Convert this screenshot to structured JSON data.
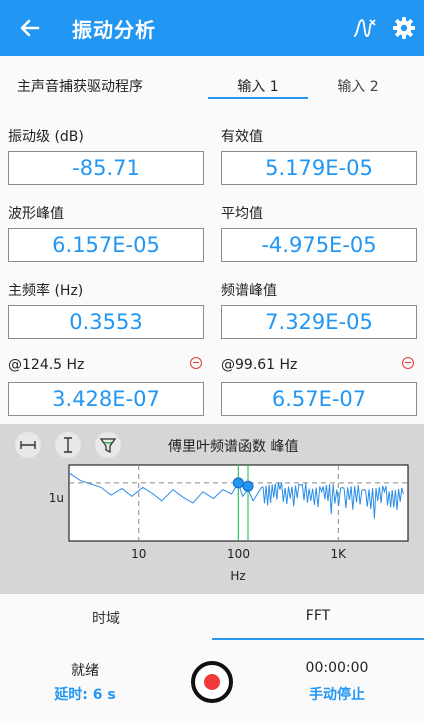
{
  "appbar": {
    "title": "振动分析"
  },
  "subhead": {
    "driver": "主声音捕获驱动程序",
    "tab_input1": "输入 1",
    "tab_input2": "输入 2"
  },
  "fields": [
    {
      "label": "振动级 (dB)",
      "value": "-85.71"
    },
    {
      "label": "有效值",
      "value": "5.179E-05"
    },
    {
      "label": "波形峰值",
      "value": "6.157E-05"
    },
    {
      "label": "平均值",
      "value": "-4.975E-05"
    },
    {
      "label": "主频率 (Hz)",
      "value": "0.3553"
    },
    {
      "label": "频谱峰值",
      "value": "7.329E-05"
    },
    {
      "label": "@124.5 Hz",
      "value": "3.428E-07"
    },
    {
      "label": "@99.61 Hz",
      "value": "6.57E-07"
    }
  ],
  "chart": {
    "title": "傅里叶频谱函数 峰值",
    "xlabel": "Hz",
    "ytick": "1u",
    "xticks": [
      "10",
      "100",
      "1K"
    ]
  },
  "chart_data": {
    "type": "line",
    "title": "傅里叶频谱函数 峰值",
    "xlabel": "Hz",
    "ylabel": "",
    "xscale": "log",
    "xlim": [
      2,
      5000
    ],
    "ylim": [
      -2.6,
      0.8
    ],
    "ytick_labels": [
      "1u"
    ],
    "xtick_labels": [
      "10",
      "100",
      "1K"
    ],
    "series": [
      {
        "values_note": "",
        "x": [
          2,
          2.6,
          3.3,
          4.2,
          5.3,
          6.8,
          8.5,
          11,
          14,
          17,
          22,
          28,
          35,
          44,
          56,
          70,
          85,
          99.61,
          110,
          124.5,
          140,
          170,
          210,
          260,
          330,
          420,
          530,
          680,
          850,
          1100,
          1400,
          1800,
          2300,
          2900,
          3600,
          4500
        ],
        "y": [
          0.45,
          0.1,
          -0.05,
          -0.2,
          -0.55,
          -0.25,
          -0.6,
          -0.2,
          -0.5,
          -0.8,
          -0.3,
          -0.65,
          -0.9,
          -0.4,
          -0.7,
          -0.3,
          -0.5,
          0.0,
          -0.6,
          -0.3,
          -0.8,
          -0.2,
          -0.9,
          -0.3,
          -0.7,
          -0.1,
          -0.8,
          -0.4,
          -1.4,
          -0.2,
          -1.2,
          -0.3,
          -1.6,
          -0.4,
          -1.1,
          -0.5
        ]
      }
    ],
    "markers": [
      {
        "x": 99.61
      },
      {
        "x": 124.5
      }
    ],
    "grid": true
  },
  "bottomtabs": {
    "time": "时域",
    "fft": "FFT"
  },
  "status": {
    "ready": "就绪",
    "delay": "延时: 6 s",
    "timer": "00:00:00",
    "stop": "手动停止"
  },
  "colors": {
    "accent": "#2196f3",
    "trace": "#2a8ee8",
    "cursor": "#35c46a",
    "warn": "#e53935",
    "record": "#f03a3a"
  },
  "icons": {
    "back": "back-arrow-icon",
    "wave": "waveform-icon",
    "settings": "gear-icon"
  }
}
